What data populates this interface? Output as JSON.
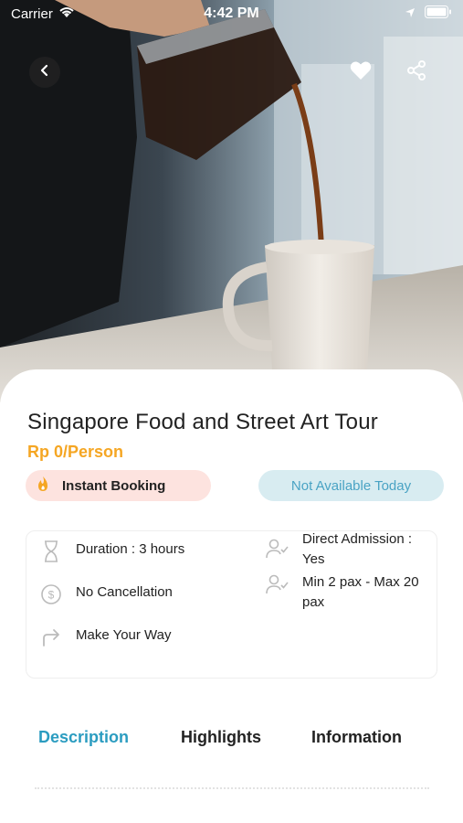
{
  "status_bar": {
    "carrier": "Carrier",
    "time": "4:42 PM"
  },
  "nav": {
    "back_icon": "chevron-left-icon",
    "favorite_icon": "heart-icon",
    "share_icon": "share-icon"
  },
  "tour": {
    "title": "Singapore Food and Street Art Tour",
    "price": "Rp 0/Person",
    "booking_badge": "Instant Booking",
    "availability_badge": "Not Available Today"
  },
  "info": {
    "duration": "Duration : 3 hours",
    "cancellation": "No Cancellation",
    "getting_there": "Make Your Way",
    "admission": "Direct Admission : Yes",
    "pax": "Min 2 pax - Max 20 pax"
  },
  "tabs": [
    {
      "label": "Description",
      "active": true
    },
    {
      "label": "Highlights",
      "active": false
    },
    {
      "label": "Information",
      "active": false
    }
  ],
  "colors": {
    "accent": "#2b9cc0",
    "price": "#f5a623",
    "instant_bg": "#fde3df",
    "avail_bg": "#d8ecf1",
    "avail_text": "#4aa3c4"
  }
}
